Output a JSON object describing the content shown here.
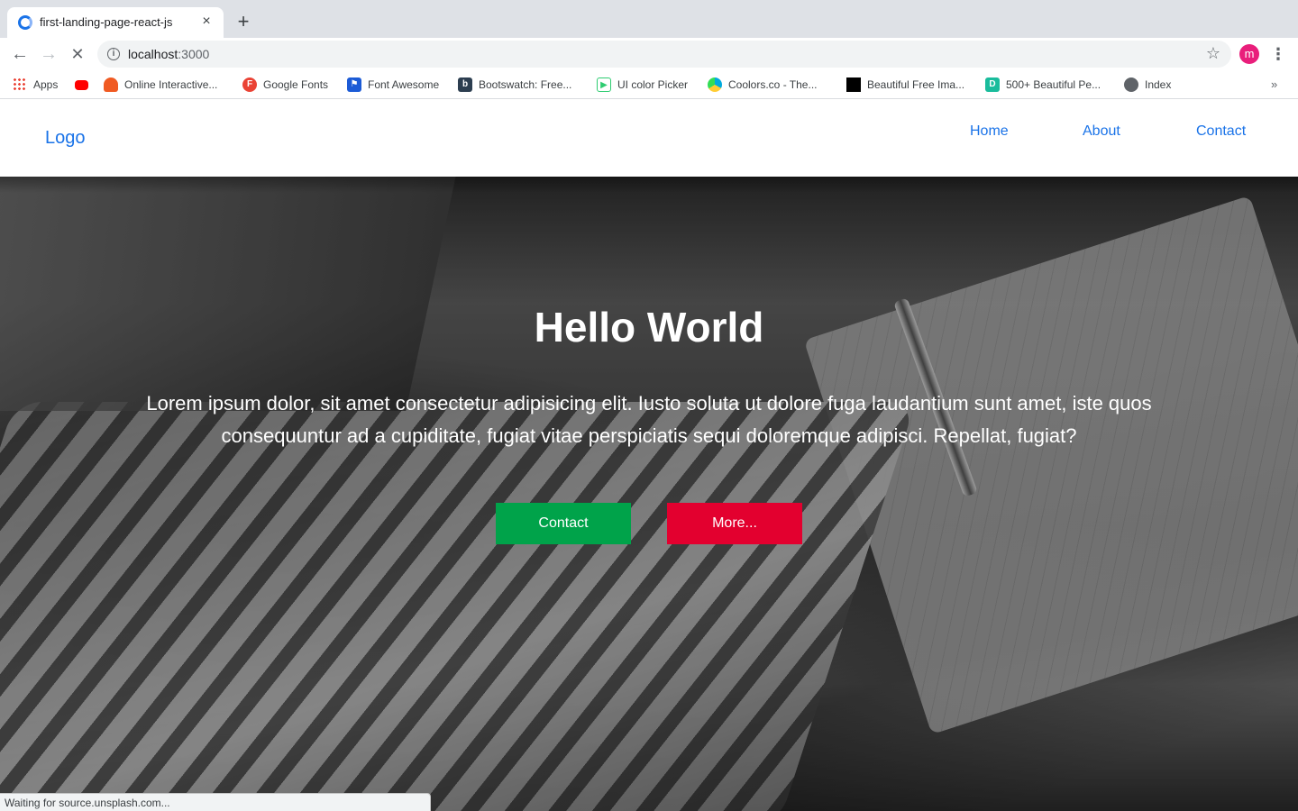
{
  "browser": {
    "tab_title": "first-landing-page-react-js",
    "tab_close": "×",
    "new_tab": "+",
    "url_host": "localhost",
    "url_port": ":3000",
    "avatar_letter": "m",
    "status_text": "Waiting for source.unsplash.com..."
  },
  "bookmarks": [
    {
      "label": "Apps",
      "icon": "apps-grid-icon"
    },
    {
      "label": "",
      "icon": "youtube-icon"
    },
    {
      "label": "Online Interactive...",
      "icon": "flame-icon"
    },
    {
      "label": "Google Fonts",
      "icon": "google-fonts-icon"
    },
    {
      "label": "Font Awesome",
      "icon": "flag-icon"
    },
    {
      "label": "Bootswatch: Free...",
      "icon": "bootswatch-icon"
    },
    {
      "label": "UI color Picker",
      "icon": "play-icon"
    },
    {
      "label": "Coolors.co - The...",
      "icon": "coolors-icon"
    },
    {
      "label": "Beautiful Free Ima...",
      "icon": "unsplash-icon"
    },
    {
      "label": "500+ Beautiful Pe...",
      "icon": "d-icon"
    },
    {
      "label": "Index",
      "icon": "globe-icon"
    }
  ],
  "site": {
    "logo": "Logo",
    "nav": [
      "Home",
      "About",
      "Contact"
    ],
    "hero_title": "Hello World",
    "hero_text": "Lorem ipsum dolor, sit amet consectetur adipisicing elit. Iusto soluta ut dolore fuga laudantium sunt amet, iste quos consequuntur ad a cupiditate, fugiat vitae perspiciatis sequi doloremque adipisci. Repellat, fugiat?",
    "btn_contact": "Contact",
    "btn_more": "More..."
  },
  "colors": {
    "link_blue": "#1a73e8",
    "contact_green": "#00a34a",
    "more_red": "#e3002f"
  }
}
